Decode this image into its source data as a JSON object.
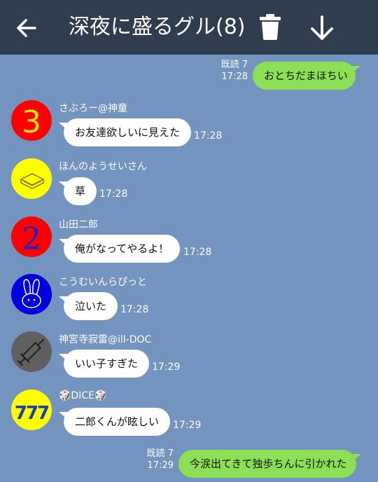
{
  "header": {
    "title": "深夜に盛るグル(8)",
    "back_icon": "arrow-left-icon",
    "trash_icon": "trash-icon",
    "download_icon": "arrow-down-icon"
  },
  "messages": [
    {
      "type": "out",
      "text": "おとちだまほちい",
      "read": "既読 7",
      "time": "17:28"
    },
    {
      "type": "in",
      "sender": "さぶろー@神童",
      "text": "お友達欲しいに見えた",
      "time": "17:28",
      "avatar": "number-3-avatar"
    },
    {
      "type": "in",
      "sender": "ほんのようせいさん",
      "text": "草",
      "time": "17:28",
      "avatar": "book-avatar"
    },
    {
      "type": "in",
      "sender": "山田二郎",
      "text": "俺がなってやるよ！",
      "time": "17:28",
      "avatar": "number-2-avatar"
    },
    {
      "type": "in",
      "sender": "こうむいんらぴっと",
      "text": "泣いた",
      "time": "17:28",
      "avatar": "rabbit-avatar"
    },
    {
      "type": "in",
      "sender": "神宮寺寂雷@ill-DOC",
      "text": "いい子すぎた",
      "time": "17:29",
      "avatar": "syringe-avatar"
    },
    {
      "type": "in",
      "sender": "🎲DICE🎲",
      "text": "二郎くんが眩しい",
      "time": "17:29",
      "avatar": "777-avatar"
    },
    {
      "type": "out",
      "text": "今涙出てきて独歩ちんに引かれた",
      "read": "既読 7",
      "time": "17:29"
    }
  ],
  "colors": {
    "background": "#7294be",
    "header": "#2f3d4e",
    "outgoing_bubble": "#8de055",
    "incoming_bubble": "#ffffff"
  }
}
